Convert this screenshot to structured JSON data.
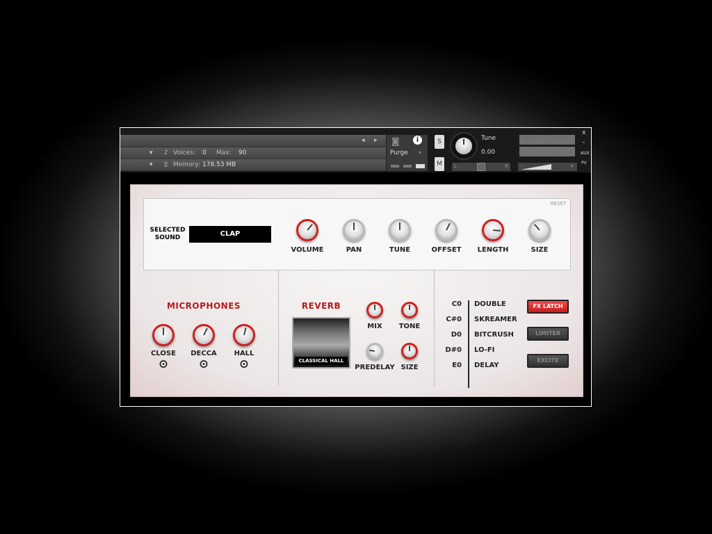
{
  "header": {
    "voices_label": "Voices:",
    "voices": "0",
    "max_label": "Max:",
    "max": "90",
    "memory_label": "Memory:",
    "memory": "178.53 MB",
    "purge": "Purge",
    "solo": "S",
    "mute": "M",
    "tune_label": "Tune",
    "tune_value": "0.00",
    "pan_l": "L",
    "pan_r": "R",
    "close": "x",
    "minimize": "–",
    "aux": "AUX",
    "pv": "PV",
    "vol_minus": "–",
    "vol_plus": "+"
  },
  "top": {
    "reset": "RESET",
    "selected_sound_label": "SELECTED SOUND",
    "selected_sound": "CLAP",
    "knobs": [
      {
        "label": "VOLUME",
        "value": 0.65,
        "style": "red"
      },
      {
        "label": "PAN",
        "value": 0.5,
        "style": "grey"
      },
      {
        "label": "TUNE",
        "value": 0.5,
        "style": "grey"
      },
      {
        "label": "OFFSET",
        "value": 0.6,
        "style": "grey"
      },
      {
        "label": "LENGTH",
        "value": 0.85,
        "style": "red"
      },
      {
        "label": "SIZE",
        "value": 0.35,
        "style": "grey"
      }
    ]
  },
  "microphones": {
    "title": "MICROPHONES",
    "knobs": [
      {
        "label": "CLOSE",
        "value": 0.5
      },
      {
        "label": "DECCA",
        "value": 0.6
      },
      {
        "label": "HALL",
        "value": 0.55
      }
    ]
  },
  "reverb": {
    "title": "REVERB",
    "preset": "CLASSICAL HALL",
    "knobs": [
      {
        "label": "MIX",
        "value": 0.5,
        "style": "red"
      },
      {
        "label": "TONE",
        "value": 0.5,
        "style": "red"
      },
      {
        "label": "PREDELAY",
        "value": 0.2,
        "style": "grey"
      },
      {
        "label": "SIZE",
        "value": 0.5,
        "style": "red"
      }
    ]
  },
  "fx": {
    "items": [
      {
        "key": "C0",
        "name": "DOUBLE"
      },
      {
        "key": "C#0",
        "name": "SKREAMER"
      },
      {
        "key": "D0",
        "name": "BITCRUSH"
      },
      {
        "key": "D#0",
        "name": "LO-FI"
      },
      {
        "key": "E0",
        "name": "DELAY"
      }
    ],
    "buttons": [
      {
        "label": "FX LATCH",
        "active": true
      },
      {
        "label": "LIMITER",
        "active": false
      },
      {
        "label": "EXCITE",
        "active": false
      }
    ]
  },
  "colors": {
    "accent": "#d02020"
  }
}
